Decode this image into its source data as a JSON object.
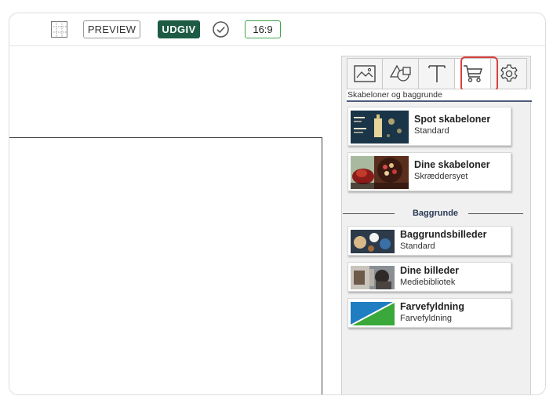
{
  "toolbar": {
    "grid_icon": "grid-icon",
    "preview_label": "PREVIEW",
    "publish_label": "UDGIV",
    "check_icon": "check-circle-icon",
    "aspect_ratio": "16:9",
    "colors": {
      "publish_bg": "#1e5b44",
      "ratio_border": "#3fa34d"
    }
  },
  "panel": {
    "tabs": [
      {
        "icon": "image-icon"
      },
      {
        "icon": "shapes-icon"
      },
      {
        "icon": "text-icon"
      },
      {
        "icon": "cart-icon",
        "active": true
      },
      {
        "icon": "gear-icon"
      }
    ],
    "section_title": "Skabeloner og baggrunde",
    "templates": [
      {
        "title": "Spot skabeloner",
        "subtitle": "Standard"
      },
      {
        "title": "Dine skabeloner",
        "subtitle": "Skræddersyet"
      }
    ],
    "backgrounds_heading": "Baggrunde",
    "backgrounds": [
      {
        "title": "Baggrundsbilleder",
        "subtitle": "Standard"
      },
      {
        "title": "Dine billeder",
        "subtitle": "Mediebibliotek"
      },
      {
        "title": "Farvefyldning",
        "subtitle": "Farvefyldning"
      }
    ],
    "highlight_color": "#d94040"
  }
}
